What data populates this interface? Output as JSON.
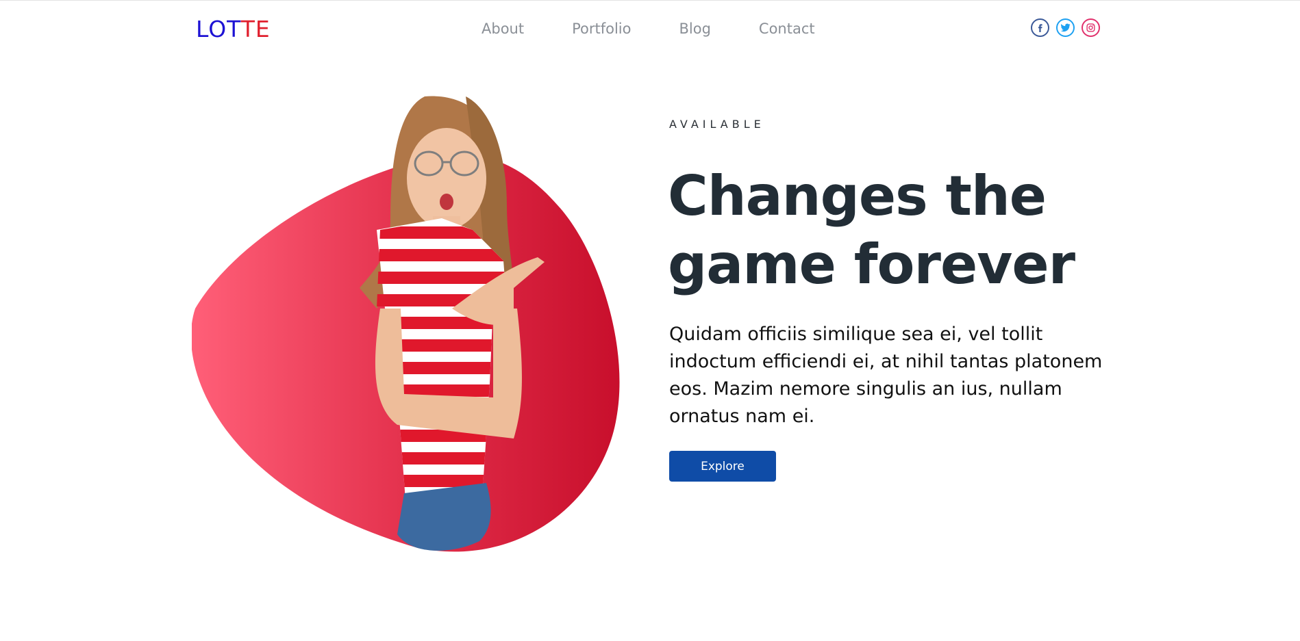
{
  "brand": {
    "logo_part1": "LOT",
    "logo_part2": "TE"
  },
  "nav": {
    "items": [
      "About",
      "Portfolio",
      "Blog",
      "Contact"
    ]
  },
  "social": {
    "icons": [
      "facebook-icon",
      "twitter-icon",
      "instagram-icon"
    ]
  },
  "hero": {
    "eyebrow": "AVAILABLE",
    "headline_line1": "Changes the",
    "headline_line2": "game forever",
    "body": "Quidam officiis similique sea ei, vel tollit indoctum efficiendi ei, at nihil tantas platonem eos. Mazim nemore singulis an ius, nullam ornatus nam ei.",
    "cta_label": "Explore"
  },
  "colors": {
    "logo_blue": "#1d12d4",
    "logo_red": "#e01f2d",
    "heading": "#222d36",
    "cta": "#0f4ca7",
    "blob": "#e6304f"
  }
}
